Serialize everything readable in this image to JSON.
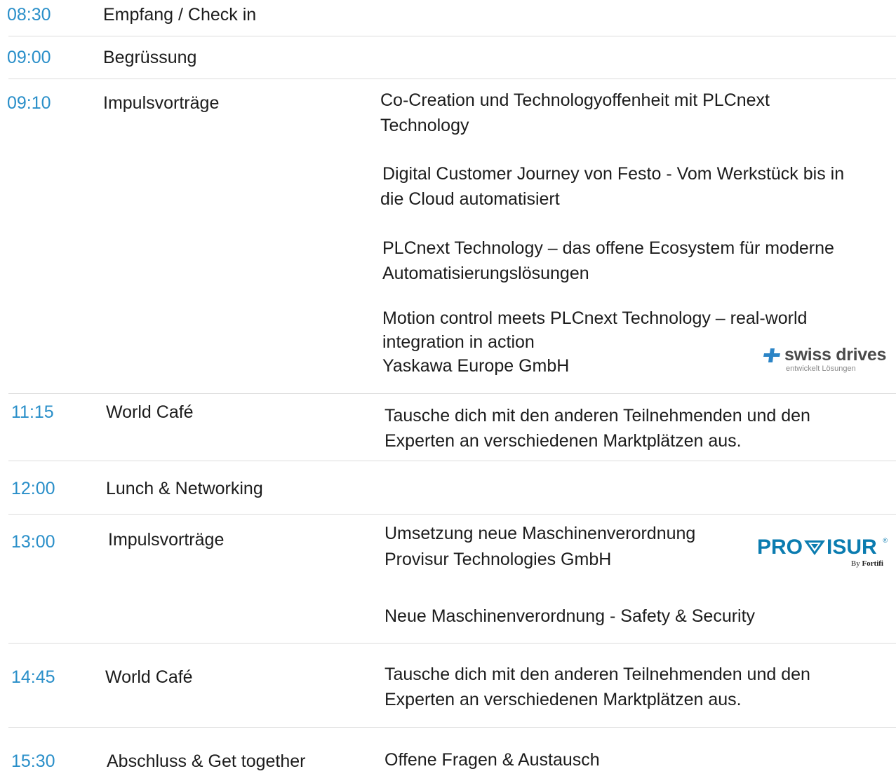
{
  "colors": {
    "time": "#2a8fc9",
    "text": "#1c1c1c",
    "separator": "#dcdcdc",
    "provisur": "#0b7cb0",
    "swiss_cross": "#2b84c6",
    "swiss_text": "#4a4a4a"
  },
  "agenda": [
    {
      "time": "08:30",
      "title": "Empfang / Check in"
    },
    {
      "time": "09:00",
      "title": "Begrüssung"
    },
    {
      "time": "09:10",
      "title": "Impulsvorträge",
      "talks": [
        [
          "Co-Creation und Technologyoffenheit mit PLCnext",
          "Technology"
        ],
        [
          "Digital Customer Journey von Festo - Vom Werkstück bis in",
          "die Cloud automatisiert"
        ],
        [
          "PLCnext Technology – das offene Ecosystem für moderne",
          "Automatisierungslösungen"
        ],
        [
          "Motion control meets PLCnext Technology – real-world",
          "integration in action",
          "Yaskawa Europe GmbH"
        ]
      ]
    },
    {
      "time": "11:15",
      "title": "World Café",
      "talks": [
        [
          "Tausche dich mit den anderen Teilnehmenden und den",
          "Experten an verschiedenen Marktplätzen aus."
        ]
      ]
    },
    {
      "time": "12:00",
      "title": "Lunch & Networking"
    },
    {
      "time": "13:00",
      "title": "Impulsvorträge",
      "talks": [
        [
          "Umsetzung neue Maschinenverordnung",
          "Provisur Technologies GmbH"
        ],
        [
          "Neue Maschinenverordnung - Safety & Security"
        ]
      ]
    },
    {
      "time": "14:45",
      "title": "World Café",
      "talks": [
        [
          "Tausche dich mit den anderen Teilnehmenden und den",
          "Experten an verschiedenen Marktplätzen aus."
        ]
      ]
    },
    {
      "time": "15:30",
      "title": "Abschluss & Get together",
      "talks": [
        [
          "Offene Fragen & Austausch"
        ]
      ]
    }
  ],
  "logos": {
    "swiss_drives": {
      "icon": "swiss-cross-icon",
      "name": "swiss drives",
      "tagline": "entwickelt Lösungen"
    },
    "provisur": {
      "name_left": "PRO",
      "name_right": "ISUR",
      "icon": "diamond-v-icon",
      "reg": "®",
      "by_prefix": "By",
      "by_name": "Fortifi"
    }
  }
}
